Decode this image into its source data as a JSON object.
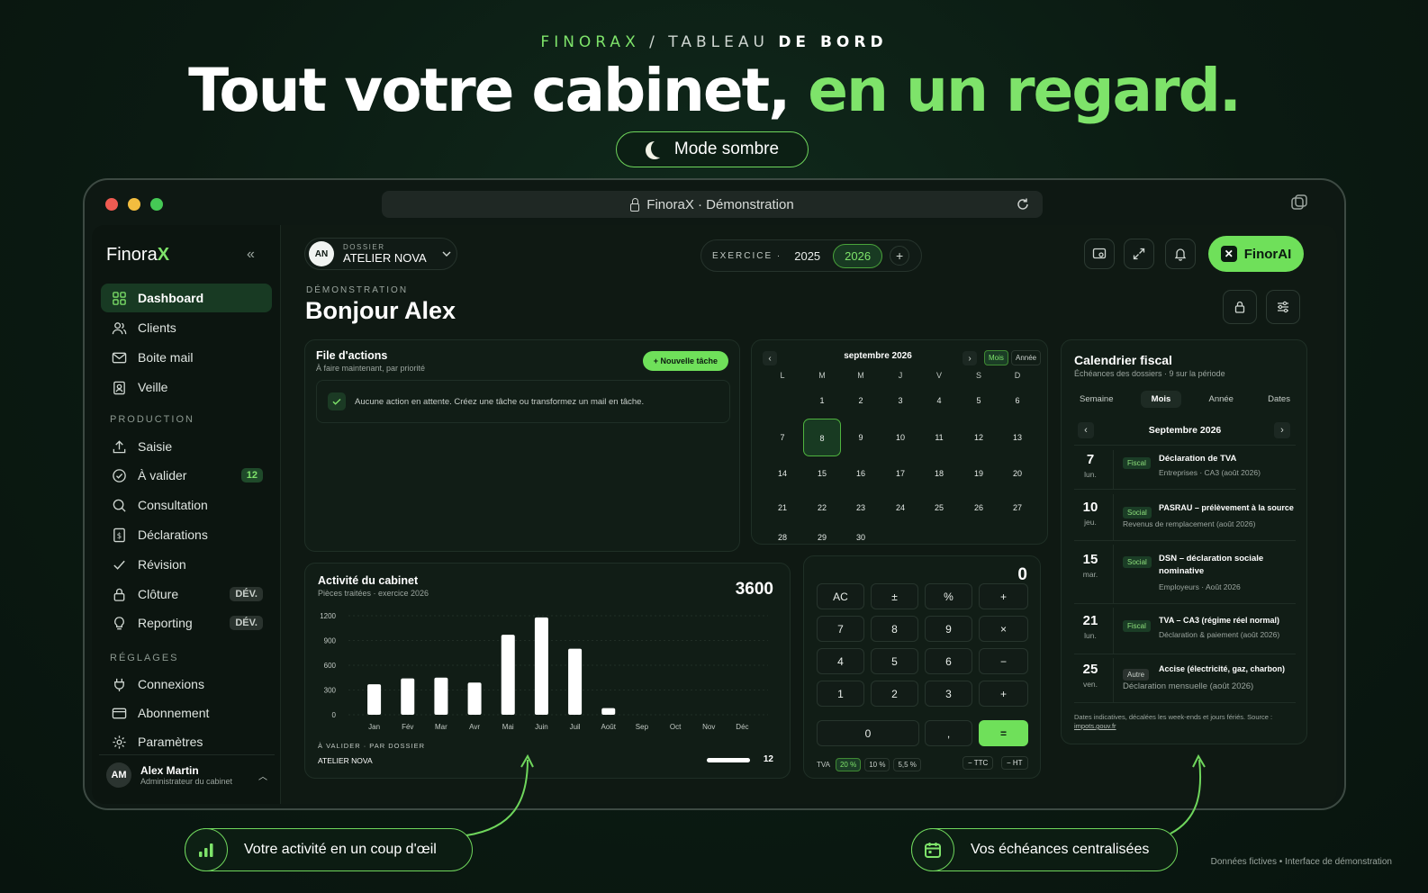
{
  "header": {
    "eyebrow_brand": "FINORAX",
    "eyebrow_sep": " / ",
    "eyebrow_part1": "TABLEAU ",
    "eyebrow_part2": "DE BORD",
    "hero_white": "Tout votre cabinet, ",
    "hero_green": "en un regard.",
    "mode_button": "Mode sombre"
  },
  "browser": {
    "url_text": "FinoraX · Démonstration"
  },
  "sidebar": {
    "brand_name": "Finora",
    "brand_suffix": "X",
    "collapse": "«",
    "main_items": [
      {
        "label": "Dashboard",
        "icon": "grid-icon"
      },
      {
        "label": "Clients",
        "icon": "users-icon"
      },
      {
        "label": "Boite mail",
        "icon": "mail-icon"
      },
      {
        "label": "Veille",
        "icon": "clipboard-icon"
      }
    ],
    "production_label": "PRODUCTION",
    "production_items": [
      {
        "label": "Saisie",
        "icon": "upload-icon"
      },
      {
        "label": "À valider",
        "icon": "check-circle-icon",
        "badge": "12"
      },
      {
        "label": "Consultation",
        "icon": "search-icon"
      },
      {
        "label": "Déclarations",
        "icon": "document-icon"
      },
      {
        "label": "Révision",
        "icon": "check-icon"
      },
      {
        "label": "Clôture",
        "icon": "lock-icon",
        "badge": "DÉV."
      },
      {
        "label": "Reporting",
        "icon": "bulb-icon",
        "badge": "DÉV."
      }
    ],
    "settings_label": "RÉGLAGES",
    "settings_items": [
      {
        "label": "Connexions",
        "icon": "plug-icon"
      },
      {
        "label": "Abonnement",
        "icon": "card-icon"
      },
      {
        "label": "Paramètres",
        "icon": "gear-icon"
      }
    ],
    "user": {
      "initials": "AM",
      "name": "Alex Martin",
      "role": "Administrateur du cabinet"
    }
  },
  "topbar": {
    "dossier_initials": "AN",
    "dossier_label": "DOSSIER",
    "dossier_name": "ATELIER NOVA",
    "exercice_label": "EXERCICE ·",
    "year_1": "2025",
    "year_2": "2026",
    "ai_button": "FinorAI"
  },
  "greeting": {
    "eyebrow": "DÉMONSTRATION",
    "title": "Bonjour Alex"
  },
  "actions": {
    "title": "File d'actions",
    "subtitle": "À faire maintenant, par priorité",
    "new_task": "+ Nouvelle tâche",
    "empty": "Aucune action en attente. Créez une tâche ou transformez un mail en tâche."
  },
  "calendar": {
    "month": "septembre 2026",
    "view_month": "Mois",
    "view_year": "Année",
    "weekdays": [
      "L",
      "M",
      "M",
      "J",
      "V",
      "S",
      "D"
    ],
    "weeks": [
      [
        "",
        "1",
        "2",
        "3",
        "4",
        "5",
        "6"
      ],
      [
        "7",
        "8",
        "9",
        "10",
        "11",
        "12",
        "13"
      ],
      [
        "14",
        "15",
        "16",
        "17",
        "18",
        "19",
        "20"
      ],
      [
        "21",
        "22",
        "23",
        "24",
        "25",
        "26",
        "27"
      ],
      [
        "28",
        "29",
        "30",
        "",
        "",
        "",
        ""
      ]
    ],
    "selected": "8"
  },
  "activity": {
    "title": "Activité du cabinet",
    "subtitle": "Pièces traitées · exercice 2026",
    "total": "3600",
    "to_validate_label": "À VALIDER · PAR DOSSIER",
    "dossier": "ATELIER NOVA",
    "dossier_count": "12",
    "dossier_progress": 1.0
  },
  "chart_data": {
    "type": "bar",
    "categories": [
      "Jan",
      "Fév",
      "Mar",
      "Avr",
      "Mai",
      "Juin",
      "Juil",
      "Août",
      "Sep",
      "Oct",
      "Nov",
      "Déc"
    ],
    "values": [
      370,
      440,
      450,
      390,
      970,
      1180,
      800,
      80,
      0,
      0,
      0,
      0
    ],
    "yticks": [
      0,
      300,
      600,
      900,
      1200
    ],
    "ylim": [
      0,
      1200
    ],
    "color": "#ffffff"
  },
  "calculator": {
    "display": "0",
    "keys": [
      [
        "AC",
        "±",
        "%",
        "+"
      ],
      [
        "7",
        "8",
        "9",
        "×"
      ],
      [
        "4",
        "5",
        "6",
        "−"
      ],
      [
        "1",
        "2",
        "3",
        "+"
      ]
    ],
    "zero": "0",
    "comma": ",",
    "equals": "=",
    "tva_label": "TVA",
    "tva_rates": [
      "20 %",
      "10 %",
      "5,5 %"
    ],
    "ttc": "− TTC",
    "ht": "− HT"
  },
  "fiscal": {
    "title": "Calendrier fiscal",
    "subtitle": "Échéances des dossiers · 9 sur la période",
    "tabs": [
      "Semaine",
      "Mois",
      "Année",
      "Dates"
    ],
    "active_tab": "Mois",
    "month": "Septembre 2026",
    "events": [
      {
        "day": "7",
        "weekday": "lun.",
        "tag": "Fiscal",
        "title": "Déclaration de TVA",
        "detail": "Entreprises · CA3 (août 2026)"
      },
      {
        "day": "10",
        "weekday": "jeu.",
        "tag": "Social",
        "title": "PASRAU – prélèvement à la source",
        "detail": "Revenus de remplacement (août 2026)"
      },
      {
        "day": "15",
        "weekday": "mar.",
        "tag": "Social",
        "title": "DSN – déclaration sociale nominative",
        "detail": "Employeurs · Août 2026"
      },
      {
        "day": "21",
        "weekday": "lun.",
        "tag": "Fiscal",
        "title": "TVA – CA3 (régime réel normal)",
        "detail": "Déclaration & paiement (août 2026)"
      },
      {
        "day": "25",
        "weekday": "ven.",
        "tag": "Autre",
        "title": "Accise (électricité, gaz, charbon)",
        "detail": "Déclaration mensuelle (août 2026)"
      }
    ],
    "footnote": "Dates indicatives, décalées les week-ends et jours fériés. Source :",
    "footnote_link": "impots.gouv.fr"
  },
  "callouts": {
    "left": "Votre activité en un coup d'œil",
    "right": "Vos échéances centralisées"
  },
  "footer": "Données fictives • Interface de démonstration"
}
